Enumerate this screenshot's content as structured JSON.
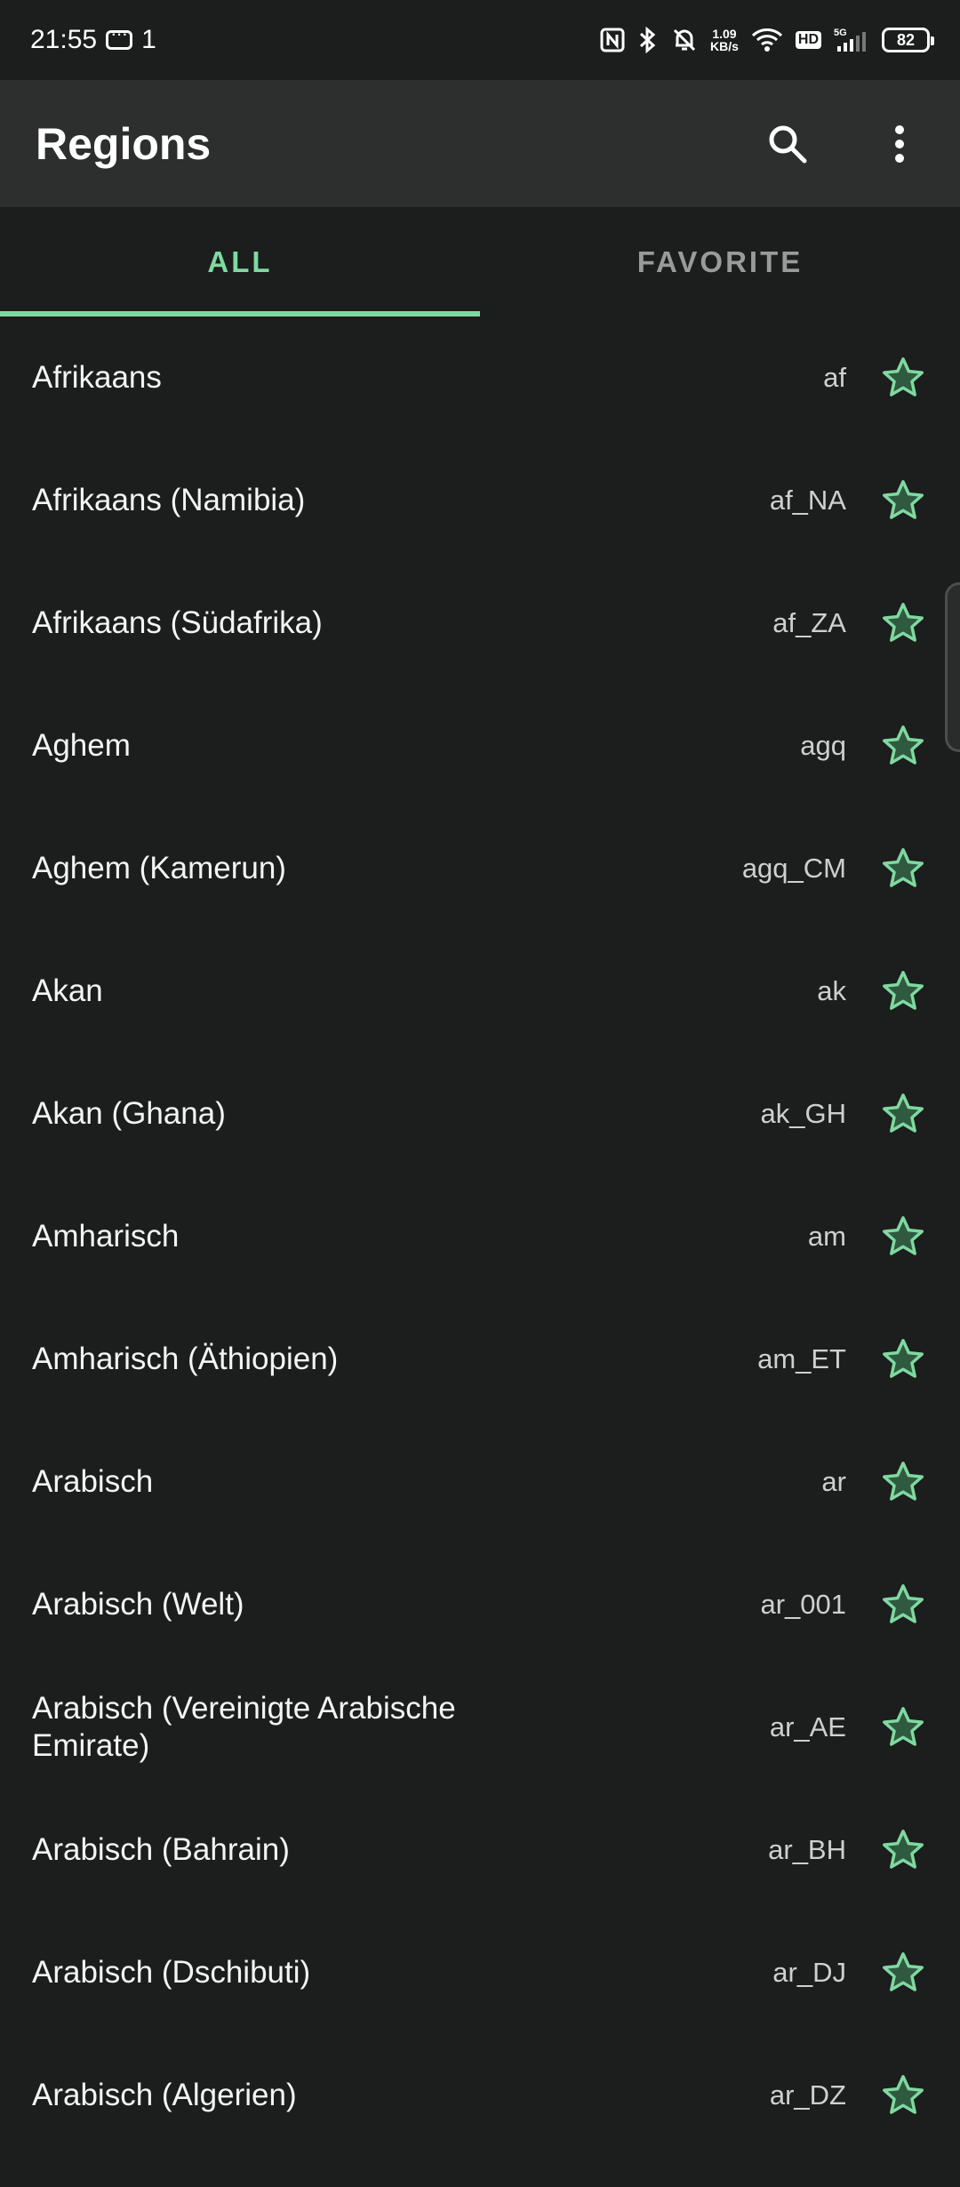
{
  "status_bar": {
    "time": "21:55",
    "notif_count": "1",
    "speed_top": "1.09",
    "speed_unit": "KB/s",
    "hd": "HD",
    "network": "5G",
    "battery": "82"
  },
  "app_bar": {
    "title": "Regions"
  },
  "tabs": [
    {
      "label": "ALL",
      "active": true
    },
    {
      "label": "FAVORITE",
      "active": false
    }
  ],
  "colors": {
    "accent": "#7fd9a0",
    "background": "#1c1d1d",
    "appbar": "#2d2e2e"
  },
  "regions": [
    {
      "name": "Afrikaans",
      "code": "af"
    },
    {
      "name": "Afrikaans (Namibia)",
      "code": "af_NA"
    },
    {
      "name": "Afrikaans (Südafrika)",
      "code": "af_ZA"
    },
    {
      "name": "Aghem",
      "code": "agq"
    },
    {
      "name": "Aghem (Kamerun)",
      "code": "agq_CM"
    },
    {
      "name": "Akan",
      "code": "ak"
    },
    {
      "name": "Akan (Ghana)",
      "code": "ak_GH"
    },
    {
      "name": "Amharisch",
      "code": "am"
    },
    {
      "name": "Amharisch (Äthiopien)",
      "code": "am_ET"
    },
    {
      "name": "Arabisch",
      "code": "ar"
    },
    {
      "name": "Arabisch (Welt)",
      "code": "ar_001"
    },
    {
      "name": "Arabisch (Vereinigte Arabische Emirate)",
      "code": "ar_AE"
    },
    {
      "name": "Arabisch (Bahrain)",
      "code": "ar_BH"
    },
    {
      "name": "Arabisch (Dschibuti)",
      "code": "ar_DJ"
    },
    {
      "name": "Arabisch (Algerien)",
      "code": "ar_DZ"
    }
  ]
}
